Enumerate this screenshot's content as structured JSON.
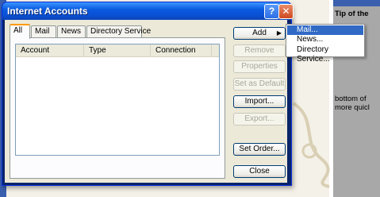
{
  "background": {
    "right_panel_lines": [
      "Tip of the",
      "bottom of",
      "more quicl"
    ]
  },
  "window": {
    "title": "Internet Accounts",
    "help_glyph": "?",
    "close_glyph": "✕"
  },
  "tabs": [
    {
      "label": "All",
      "active": true
    },
    {
      "label": "Mail",
      "active": false
    },
    {
      "label": "News",
      "active": false
    },
    {
      "label": "Directory Service",
      "active": false
    }
  ],
  "accounts_list": {
    "columns": [
      "Account",
      "Type",
      "Connection"
    ],
    "rows": []
  },
  "buttons": {
    "add": "Add",
    "remove": "Remove",
    "properties": "Properties",
    "set_default": "Set as Default",
    "import": "Import...",
    "export": "Export...",
    "set_order": "Set Order...",
    "close": "Close"
  },
  "add_menu": {
    "items": [
      "Mail...",
      "News...",
      "Directory Service..."
    ],
    "highlighted": "Mail..."
  },
  "colors": {
    "titlebar": "#0a5be0",
    "menu_highlight": "#316ac5",
    "tab_accent": "#ff9a00"
  }
}
